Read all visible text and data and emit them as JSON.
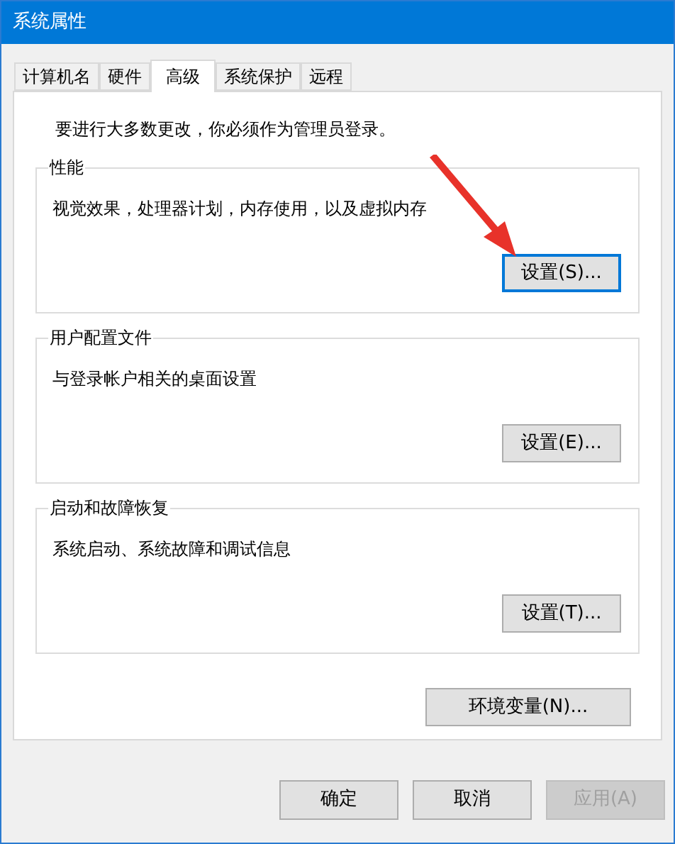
{
  "window": {
    "title": "系统属性"
  },
  "tabs": [
    {
      "label": "计算机名",
      "selected": false
    },
    {
      "label": "硬件",
      "selected": false
    },
    {
      "label": "高级",
      "selected": true
    },
    {
      "label": "系统保护",
      "selected": false
    },
    {
      "label": "远程",
      "selected": false
    }
  ],
  "notice": "要进行大多数更改，你必须作为管理员登录。",
  "groups": [
    {
      "title": "性能",
      "description": "视觉效果，处理器计划，内存使用，以及虚拟内存",
      "button": {
        "label": "设置(S)...",
        "focused": true
      }
    },
    {
      "title": "用户配置文件",
      "description": "与登录帐户相关的桌面设置",
      "button": {
        "label": "设置(E)...",
        "focused": false
      }
    },
    {
      "title": "启动和故障恢复",
      "description": "系统启动、系统故障和调试信息",
      "button": {
        "label": "设置(T)...",
        "focused": false
      }
    }
  ],
  "env_button": {
    "label": "环境变量(N)..."
  },
  "dialog_buttons": [
    {
      "label": "确定",
      "disabled": false
    },
    {
      "label": "取消",
      "disabled": false
    },
    {
      "label": "应用(A)",
      "disabled": true
    }
  ]
}
